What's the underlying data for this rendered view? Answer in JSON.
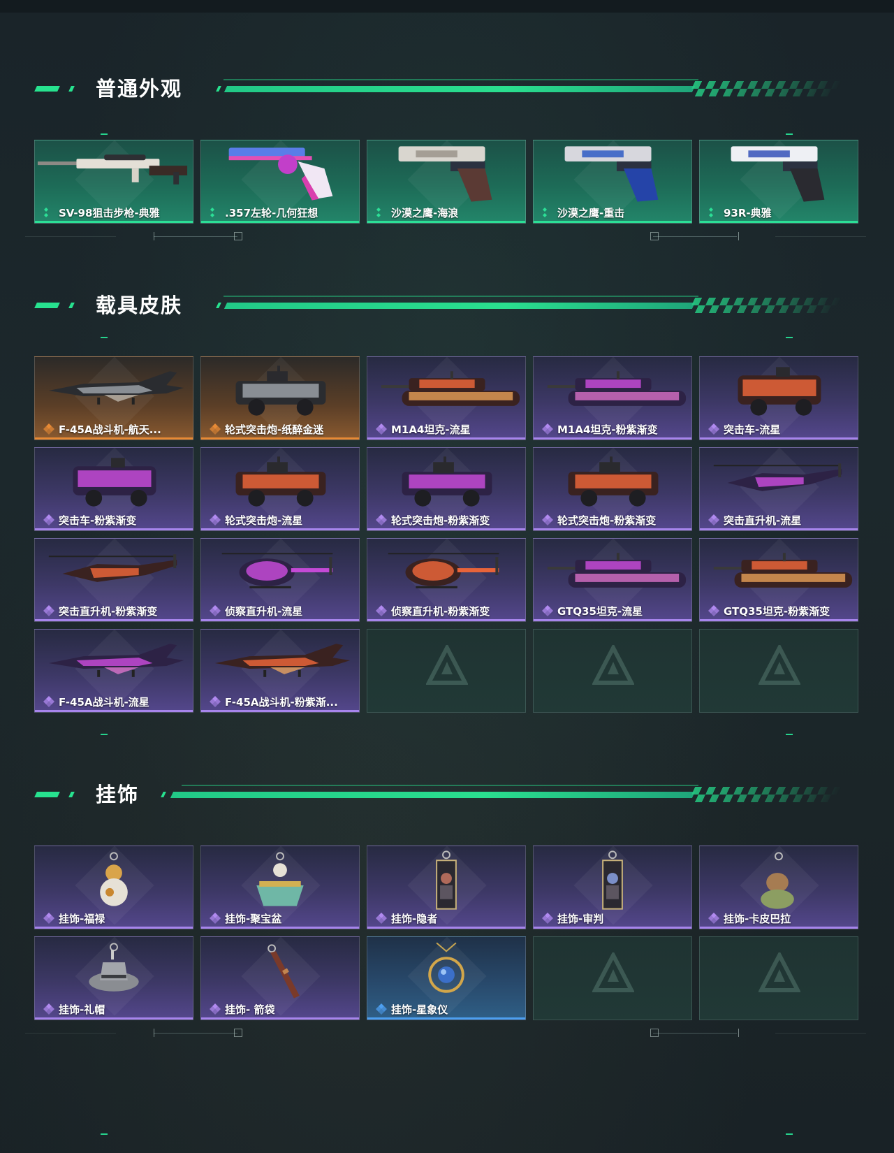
{
  "sections": {
    "weapons": {
      "title": "普通外观",
      "items": [
        {
          "label": "SV-98狙击步枪-典雅",
          "rarity": "green",
          "icon": "sniper-rifle-icon"
        },
        {
          "label": ".357左轮-几何狂想",
          "rarity": "green",
          "icon": "revolver-icon"
        },
        {
          "label": "沙漠之鹰-海浪",
          "rarity": "green",
          "icon": "pistol-icon"
        },
        {
          "label": "沙漠之鹰-重击",
          "rarity": "green",
          "icon": "pistol-icon"
        },
        {
          "label": "93R-典雅",
          "rarity": "green",
          "icon": "pistol-icon"
        }
      ]
    },
    "vehicles": {
      "title": "载具皮肤",
      "items": [
        {
          "label": "F-45A战斗机-航天...",
          "rarity": "orange",
          "icon": "fighter-jet-icon"
        },
        {
          "label": "轮式突击炮-纸醉金迷",
          "rarity": "orange",
          "icon": "armored-car-icon"
        },
        {
          "label": "M1A4坦克-流星",
          "rarity": "purple",
          "icon": "tank-icon"
        },
        {
          "label": "M1A4坦克-粉紫渐变",
          "rarity": "purple",
          "icon": "tank-icon"
        },
        {
          "label": "突击车-流星",
          "rarity": "purple",
          "icon": "assault-vehicle-icon"
        },
        {
          "label": "突击车-粉紫渐变",
          "rarity": "purple",
          "icon": "assault-vehicle-icon"
        },
        {
          "label": "轮式突击炮-流星",
          "rarity": "purple",
          "icon": "armored-car-icon"
        },
        {
          "label": "轮式突击炮-粉紫渐变",
          "rarity": "purple",
          "icon": "armored-car-icon"
        },
        {
          "label": "轮式突击炮-粉紫渐变",
          "rarity": "purple",
          "icon": "armored-car-icon"
        },
        {
          "label": "突击直升机-流星",
          "rarity": "purple",
          "icon": "helicopter-icon"
        },
        {
          "label": "突击直升机-粉紫渐变",
          "rarity": "purple",
          "icon": "helicopter-icon"
        },
        {
          "label": "侦察直升机-流星",
          "rarity": "purple",
          "icon": "scout-helicopter-icon"
        },
        {
          "label": "侦察直升机-粉紫渐变",
          "rarity": "purple",
          "icon": "scout-helicopter-icon"
        },
        {
          "label": "GTQ35坦克-流星",
          "rarity": "purple",
          "icon": "tank-icon"
        },
        {
          "label": "GTQ35坦克-粉紫渐变",
          "rarity": "purple",
          "icon": "tank-icon"
        },
        {
          "label": "F-45A战斗机-流星",
          "rarity": "purple",
          "icon": "fighter-jet-icon"
        },
        {
          "label": "F-45A战斗机-粉紫渐...",
          "rarity": "purple",
          "icon": "fighter-jet-icon"
        },
        {
          "label": "",
          "rarity": "empty",
          "icon": "empty-slot-logo-icon"
        },
        {
          "label": "",
          "rarity": "empty",
          "icon": "empty-slot-logo-icon"
        },
        {
          "label": "",
          "rarity": "empty",
          "icon": "empty-slot-logo-icon"
        }
      ]
    },
    "charms": {
      "title": "挂饰",
      "items": [
        {
          "label": "挂饰-福禄",
          "rarity": "purple",
          "icon": "gourd-charm-icon"
        },
        {
          "label": "挂饰-聚宝盆",
          "rarity": "purple",
          "icon": "treasure-bowl-charm-icon"
        },
        {
          "label": "挂饰-隐者",
          "rarity": "purple",
          "icon": "tarot-card-charm-icon"
        },
        {
          "label": "挂饰-审判",
          "rarity": "purple",
          "icon": "tarot-card-charm-icon"
        },
        {
          "label": "挂饰-卡皮巴拉",
          "rarity": "purple",
          "icon": "capybara-charm-icon"
        },
        {
          "label": "挂饰-礼帽",
          "rarity": "purple",
          "icon": "hat-charm-icon"
        },
        {
          "label": "挂饰- 箭袋",
          "rarity": "purple",
          "icon": "quiver-charm-icon"
        },
        {
          "label": "挂饰-星象仪",
          "rarity": "blue",
          "icon": "astrolabe-charm-icon"
        },
        {
          "label": "",
          "rarity": "empty",
          "icon": "empty-slot-logo-icon"
        },
        {
          "label": "",
          "rarity": "empty",
          "icon": "empty-slot-logo-icon"
        }
      ]
    }
  },
  "colors": {
    "accent": "#27e28f",
    "green": "#2cdf96",
    "orange": "#e78a35",
    "purple": "#a785ec",
    "blue": "#4d9ff0"
  }
}
